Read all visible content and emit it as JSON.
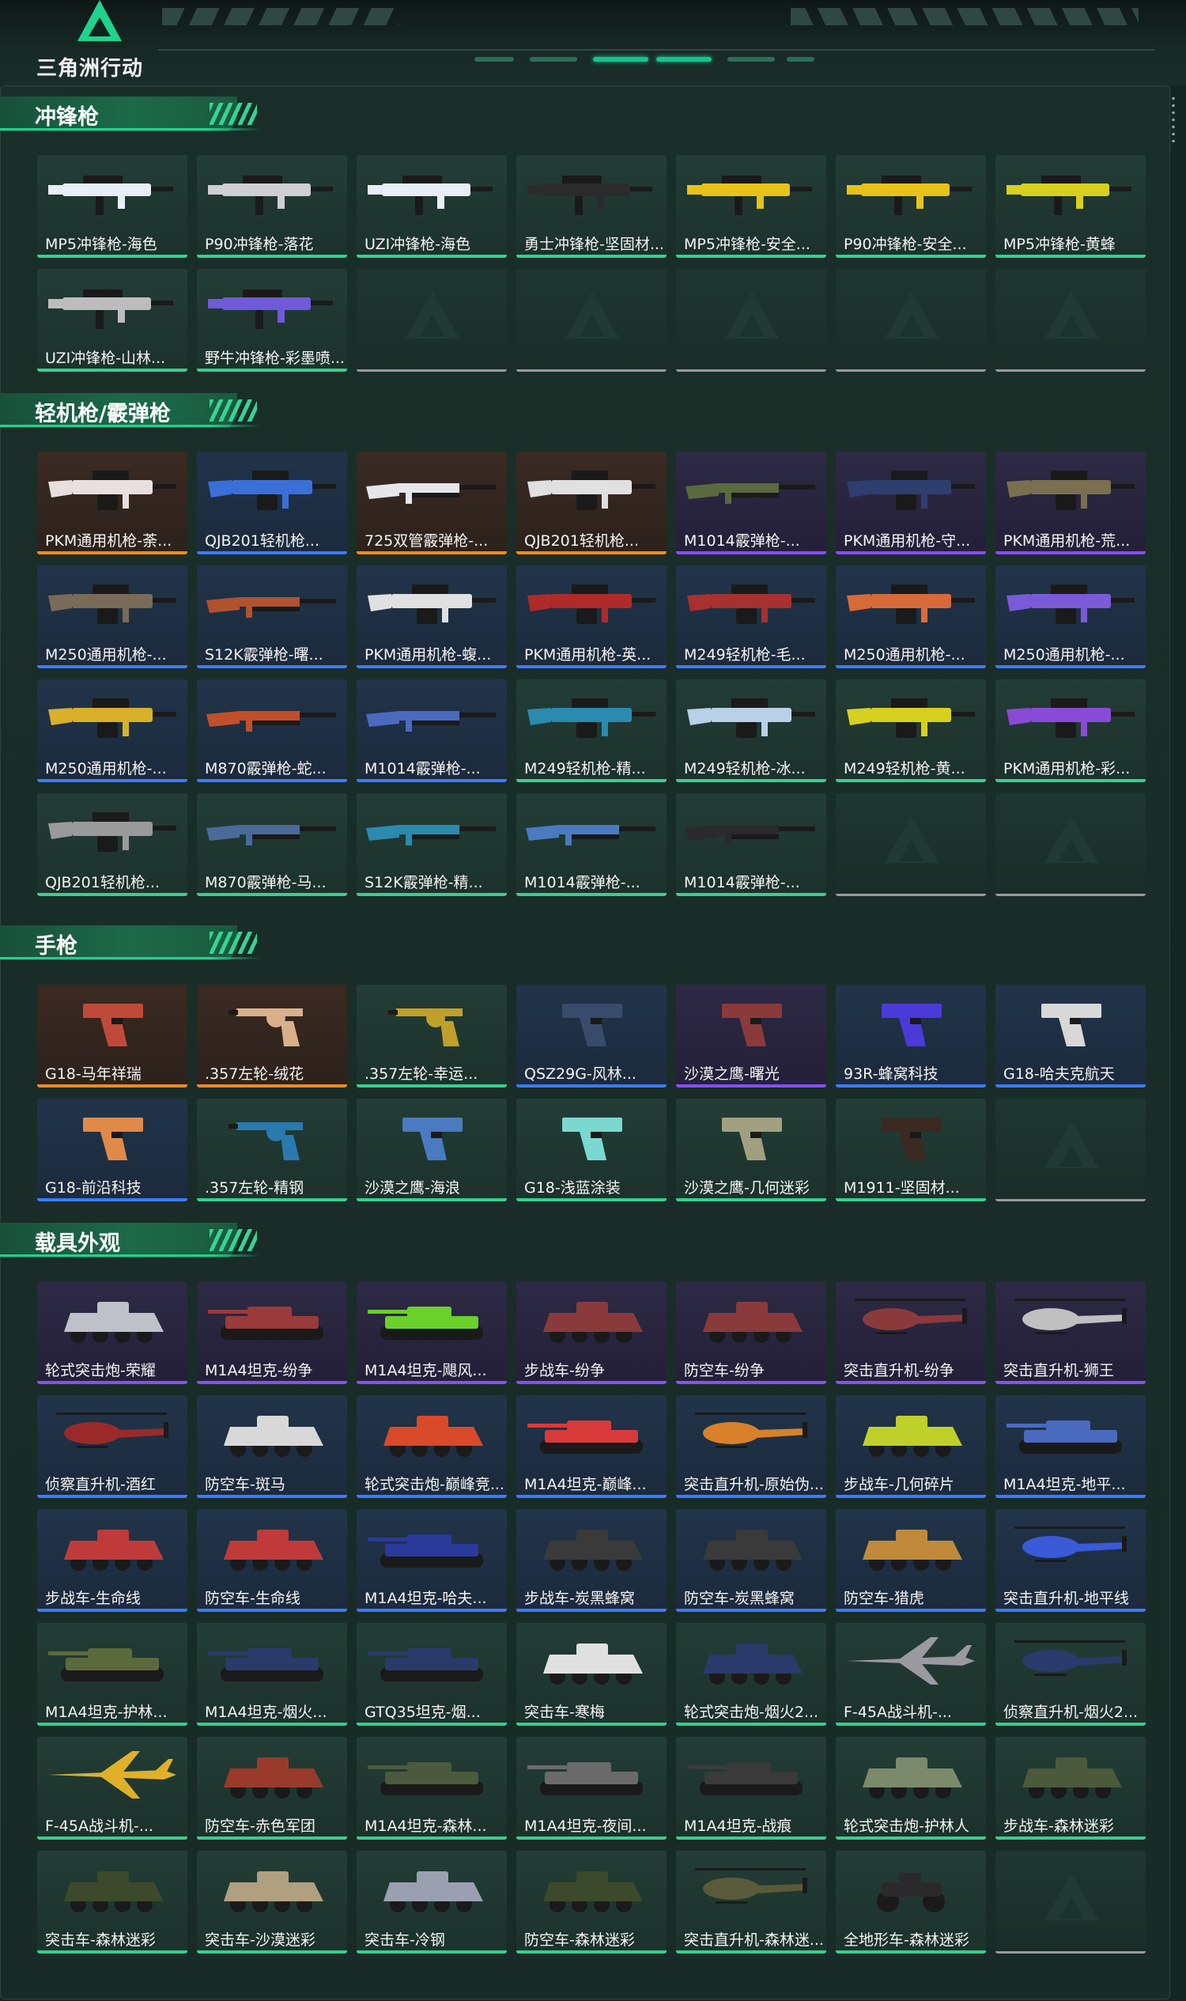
{
  "app": {
    "logo_text": "三角洲行动"
  },
  "sections": [
    {
      "title": "冲锋枪",
      "items": [
        {
          "name": "MP5冲锋枪-海色",
          "rarity": "green",
          "icon": "smg-icon",
          "color": "#e8eef6"
        },
        {
          "name": "P90冲锋枪-落花",
          "rarity": "green",
          "icon": "smg-icon",
          "color": "#cfcfd4"
        },
        {
          "name": "UZI冲锋枪-海色",
          "rarity": "green",
          "icon": "smg-icon",
          "color": "#e8eef6"
        },
        {
          "name": "勇士冲锋枪-坚固材...",
          "rarity": "green",
          "icon": "smg-icon",
          "color": "#2b2b2b"
        },
        {
          "name": "MP5冲锋枪-安全...",
          "rarity": "green",
          "icon": "smg-icon",
          "color": "#e7c31a"
        },
        {
          "name": "P90冲锋枪-安全...",
          "rarity": "green",
          "icon": "smg-icon",
          "color": "#e7c31a"
        },
        {
          "name": "MP5冲锋枪-黄蜂",
          "rarity": "green",
          "icon": "smg-icon",
          "color": "#d8d01f"
        },
        {
          "name": "UZI冲锋枪-山林...",
          "rarity": "green",
          "icon": "smg-icon",
          "color": "#bdbdbd"
        },
        {
          "name": "野牛冲锋枪-彩墨喷...",
          "rarity": "green",
          "icon": "smg-icon",
          "color": "#6f5ad8"
        },
        {
          "name": "",
          "rarity": "empty"
        },
        {
          "name": "",
          "rarity": "empty"
        },
        {
          "name": "",
          "rarity": "empty"
        },
        {
          "name": "",
          "rarity": "empty"
        },
        {
          "name": "",
          "rarity": "empty"
        }
      ]
    },
    {
      "title": "轻机枪/霰弹枪",
      "items": [
        {
          "name": "PKM通用机枪-荼...",
          "rarity": "orange",
          "icon": "lmg-icon",
          "color": "#e8e0e0"
        },
        {
          "name": "QJB201轻机枪...",
          "rarity": "blue",
          "icon": "lmg-icon",
          "color": "#3b6fd8"
        },
        {
          "name": "725双管霰弹枪-...",
          "rarity": "orange",
          "icon": "shotgun-icon",
          "color": "#e6e6ea"
        },
        {
          "name": "QJB201轻机枪...",
          "rarity": "orange",
          "icon": "lmg-icon",
          "color": "#e0e0e0"
        },
        {
          "name": "M1014霰弹枪-...",
          "rarity": "purple",
          "icon": "shotgun-icon",
          "color": "#5c6a40"
        },
        {
          "name": "PKM通用机枪-守...",
          "rarity": "purple",
          "icon": "lmg-icon",
          "color": "#2e3e6e"
        },
        {
          "name": "PKM通用机枪-荒...",
          "rarity": "purple",
          "icon": "lmg-icon",
          "color": "#7a7050"
        },
        {
          "name": "M250通用机枪-...",
          "rarity": "blue",
          "icon": "lmg-icon",
          "color": "#7a6a58"
        },
        {
          "name": "S12K霰弹枪-曙...",
          "rarity": "blue",
          "icon": "shotgun-icon",
          "color": "#b0522e"
        },
        {
          "name": "PKM通用机枪-蝮...",
          "rarity": "blue",
          "icon": "lmg-icon",
          "color": "#e0e0e0"
        },
        {
          "name": "PKM通用机枪-英...",
          "rarity": "blue",
          "icon": "lmg-icon",
          "color": "#b02a2a"
        },
        {
          "name": "M249轻机枪-毛...",
          "rarity": "blue",
          "icon": "lmg-icon",
          "color": "#a83030"
        },
        {
          "name": "M250通用机枪-...",
          "rarity": "blue",
          "icon": "lmg-icon",
          "color": "#d86a3a"
        },
        {
          "name": "M250通用机枪-...",
          "rarity": "blue",
          "icon": "lmg-icon",
          "color": "#7a5ad8"
        },
        {
          "name": "M250通用机枪-...",
          "rarity": "blue",
          "icon": "lmg-icon",
          "color": "#d8b02a"
        },
        {
          "name": "M870霰弹枪-蛇...",
          "rarity": "blue",
          "icon": "shotgun-icon",
          "color": "#c0502a"
        },
        {
          "name": "M1014霰弹枪-...",
          "rarity": "blue",
          "icon": "shotgun-icon",
          "color": "#4a6ac0"
        },
        {
          "name": "M249轻机枪-精...",
          "rarity": "green",
          "icon": "lmg-icon",
          "color": "#2a8ab0"
        },
        {
          "name": "M249轻机枪-冰...",
          "rarity": "green",
          "icon": "lmg-icon",
          "color": "#b8d0e8"
        },
        {
          "name": "M249轻机枪-黄...",
          "rarity": "green",
          "icon": "lmg-icon",
          "color": "#d8d01f"
        },
        {
          "name": "PKM通用机枪-彩...",
          "rarity": "green",
          "icon": "lmg-icon",
          "color": "#8a4ad8"
        },
        {
          "name": "QJB201轻机枪...",
          "rarity": "green",
          "icon": "lmg-icon",
          "color": "#9a9a9a"
        },
        {
          "name": "M870霰弹枪-马...",
          "rarity": "green",
          "icon": "shotgun-icon",
          "color": "#4a6a9a"
        },
        {
          "name": "S12K霰弹枪-精...",
          "rarity": "green",
          "icon": "shotgun-icon",
          "color": "#2a8ab0"
        },
        {
          "name": "M1014霰弹枪-...",
          "rarity": "green",
          "icon": "shotgun-icon",
          "color": "#4a7ac0"
        },
        {
          "name": "M1014霰弹枪-...",
          "rarity": "green",
          "icon": "shotgun-icon",
          "color": "#2a2a2a"
        },
        {
          "name": "",
          "rarity": "empty"
        },
        {
          "name": "",
          "rarity": "empty"
        }
      ]
    },
    {
      "title": "手枪",
      "items": [
        {
          "name": "G18-马年祥瑞",
          "rarity": "orange",
          "icon": "pistol-icon",
          "color": "#c04a3a"
        },
        {
          "name": ".357左轮-绒花",
          "rarity": "orange",
          "icon": "revolver-icon",
          "color": "#d8b08a"
        },
        {
          "name": ".357左轮-幸运...",
          "rarity": "green",
          "icon": "revolver-icon",
          "color": "#c0a02a"
        },
        {
          "name": "QSZ29G-风林...",
          "rarity": "blue",
          "icon": "pistol-icon",
          "color": "#3a4a6a"
        },
        {
          "name": "沙漠之鹰-曙光",
          "rarity": "purple",
          "icon": "pistol-icon",
          "color": "#8a3a3a"
        },
        {
          "name": "93R-蜂窝科技",
          "rarity": "blue",
          "icon": "pistol-icon",
          "color": "#4a3ad8"
        },
        {
          "name": "G18-哈夫克航天",
          "rarity": "blue",
          "icon": "pistol-icon",
          "color": "#d8d8d8"
        },
        {
          "name": "G18-前沿科技",
          "rarity": "blue",
          "icon": "pistol-icon",
          "color": "#e08a4a"
        },
        {
          "name": ".357左轮-精钢",
          "rarity": "green",
          "icon": "revolver-icon",
          "color": "#2a7ab0"
        },
        {
          "name": "沙漠之鹰-海浪",
          "rarity": "green",
          "icon": "pistol-icon",
          "color": "#4a7ac0"
        },
        {
          "name": "G18-浅蓝涂装",
          "rarity": "green",
          "icon": "pistol-icon",
          "color": "#7ad8d0"
        },
        {
          "name": "沙漠之鹰-几何迷彩",
          "rarity": "green",
          "icon": "pistol-icon",
          "color": "#a0a080"
        },
        {
          "name": "M1911-坚固材...",
          "rarity": "green",
          "icon": "pistol-icon",
          "color": "#3a2a22"
        },
        {
          "name": "",
          "rarity": "empty"
        }
      ]
    },
    {
      "title": "载具外观",
      "items": [
        {
          "name": "轮式突击炮-荣耀",
          "rarity": "purple",
          "icon": "vehicle-icon",
          "color": "#c0c0c8"
        },
        {
          "name": "M1A4坦克-纷争",
          "rarity": "purple",
          "icon": "tank-icon",
          "color": "#9a3a3a"
        },
        {
          "name": "M1A4坦克-飓风...",
          "rarity": "purple",
          "icon": "tank-icon",
          "color": "#6ad02a"
        },
        {
          "name": "步战车-纷争",
          "rarity": "purple",
          "icon": "vehicle-icon",
          "color": "#8a3a3a"
        },
        {
          "name": "防空车-纷争",
          "rarity": "purple",
          "icon": "vehicle-icon",
          "color": "#8a3a3a"
        },
        {
          "name": "突击直升机-纷争",
          "rarity": "purple",
          "icon": "helicopter-icon",
          "color": "#8a3a3a"
        },
        {
          "name": "突击直升机-狮王",
          "rarity": "purple",
          "icon": "helicopter-icon",
          "color": "#c0c0c0"
        },
        {
          "name": "侦察直升机-酒红",
          "rarity": "blue",
          "icon": "helicopter-icon",
          "color": "#9a2a2a"
        },
        {
          "name": "防空车-斑马",
          "rarity": "blue",
          "icon": "vehicle-icon",
          "color": "#d8d8d8"
        },
        {
          "name": "轮式突击炮-巅峰竞...",
          "rarity": "blue",
          "icon": "vehicle-icon",
          "color": "#d84a2a"
        },
        {
          "name": "M1A4坦克-巅峰...",
          "rarity": "blue",
          "icon": "tank-icon",
          "color": "#d83a3a"
        },
        {
          "name": "突击直升机-原始伪...",
          "rarity": "blue",
          "icon": "helicopter-icon",
          "color": "#d8802a"
        },
        {
          "name": "步战车-几何碎片",
          "rarity": "blue",
          "icon": "vehicle-icon",
          "color": "#c0d02a"
        },
        {
          "name": "M1A4坦克-地平...",
          "rarity": "blue",
          "icon": "tank-icon",
          "color": "#4a6ac0"
        },
        {
          "name": "步战车-生命线",
          "rarity": "blue",
          "icon": "vehicle-icon",
          "color": "#c03a3a"
        },
        {
          "name": "防空车-生命线",
          "rarity": "blue",
          "icon": "vehicle-icon",
          "color": "#c03a3a"
        },
        {
          "name": "M1A4坦克-哈夫...",
          "rarity": "blue",
          "icon": "tank-icon",
          "color": "#2a3a9a"
        },
        {
          "name": "步战车-炭黑蜂窝",
          "rarity": "blue",
          "icon": "vehicle-icon",
          "color": "#3a3a3a"
        },
        {
          "name": "防空车-炭黑蜂窝",
          "rarity": "blue",
          "icon": "vehicle-icon",
          "color": "#3a3a3a"
        },
        {
          "name": "防空车-猎虎",
          "rarity": "blue",
          "icon": "vehicle-icon",
          "color": "#c08a3a"
        },
        {
          "name": "突击直升机-地平线",
          "rarity": "blue",
          "icon": "helicopter-icon",
          "color": "#3a5ad8"
        },
        {
          "name": "M1A4坦克-护林...",
          "rarity": "green",
          "icon": "tank-icon",
          "color": "#5a6a3a"
        },
        {
          "name": "M1A4坦克-烟火...",
          "rarity": "green",
          "icon": "tank-icon",
          "color": "#2a3a6a"
        },
        {
          "name": "GTQ35坦克-烟...",
          "rarity": "green",
          "icon": "tank-icon",
          "color": "#2a3a6a"
        },
        {
          "name": "突击车-寒梅",
          "rarity": "green",
          "icon": "vehicle-icon",
          "color": "#e0e0e0"
        },
        {
          "name": "轮式突击炮-烟火2...",
          "rarity": "green",
          "icon": "vehicle-icon",
          "color": "#2a3a6a"
        },
        {
          "name": "F-45A战斗机-...",
          "rarity": "green",
          "icon": "jet-icon",
          "color": "#9a9aa0"
        },
        {
          "name": "侦察直升机-烟火2...",
          "rarity": "green",
          "icon": "helicopter-icon",
          "color": "#2a3a6a"
        },
        {
          "name": "F-45A战斗机-...",
          "rarity": "green",
          "icon": "jet-icon",
          "color": "#e0b02a"
        },
        {
          "name": "防空车-赤色军团",
          "rarity": "green",
          "icon": "vehicle-icon",
          "color": "#9a3a2a"
        },
        {
          "name": "M1A4坦克-森林...",
          "rarity": "green",
          "icon": "tank-icon",
          "color": "#4a5a3a"
        },
        {
          "name": "M1A4坦克-夜间...",
          "rarity": "green",
          "icon": "tank-icon",
          "color": "#6a6a6a"
        },
        {
          "name": "M1A4坦克-战痕",
          "rarity": "green",
          "icon": "tank-icon",
          "color": "#3a3a3a"
        },
        {
          "name": "轮式突击炮-护林人",
          "rarity": "green",
          "icon": "vehicle-icon",
          "color": "#7a8a6a"
        },
        {
          "name": "步战车-森林迷彩",
          "rarity": "green",
          "icon": "vehicle-icon",
          "color": "#4a5a3a"
        },
        {
          "name": "突击车-森林迷彩",
          "rarity": "green",
          "icon": "vehicle-icon",
          "color": "#3a4a2a"
        },
        {
          "name": "突击车-沙漠迷彩",
          "rarity": "green",
          "icon": "vehicle-icon",
          "color": "#b0a080"
        },
        {
          "name": "突击车-冷钢",
          "rarity": "green",
          "icon": "vehicle-icon",
          "color": "#9aa0b0"
        },
        {
          "name": "防空车-森林迷彩",
          "rarity": "green",
          "icon": "vehicle-icon",
          "color": "#3a4a2a"
        },
        {
          "name": "突击直升机-森林迷...",
          "rarity": "green",
          "icon": "helicopter-icon",
          "color": "#5a5a3a"
        },
        {
          "name": "全地形车-森林迷彩",
          "rarity": "green",
          "icon": "atv-icon",
          "color": "#2a2a2a"
        },
        {
          "name": "",
          "rarity": "empty"
        }
      ]
    }
  ]
}
